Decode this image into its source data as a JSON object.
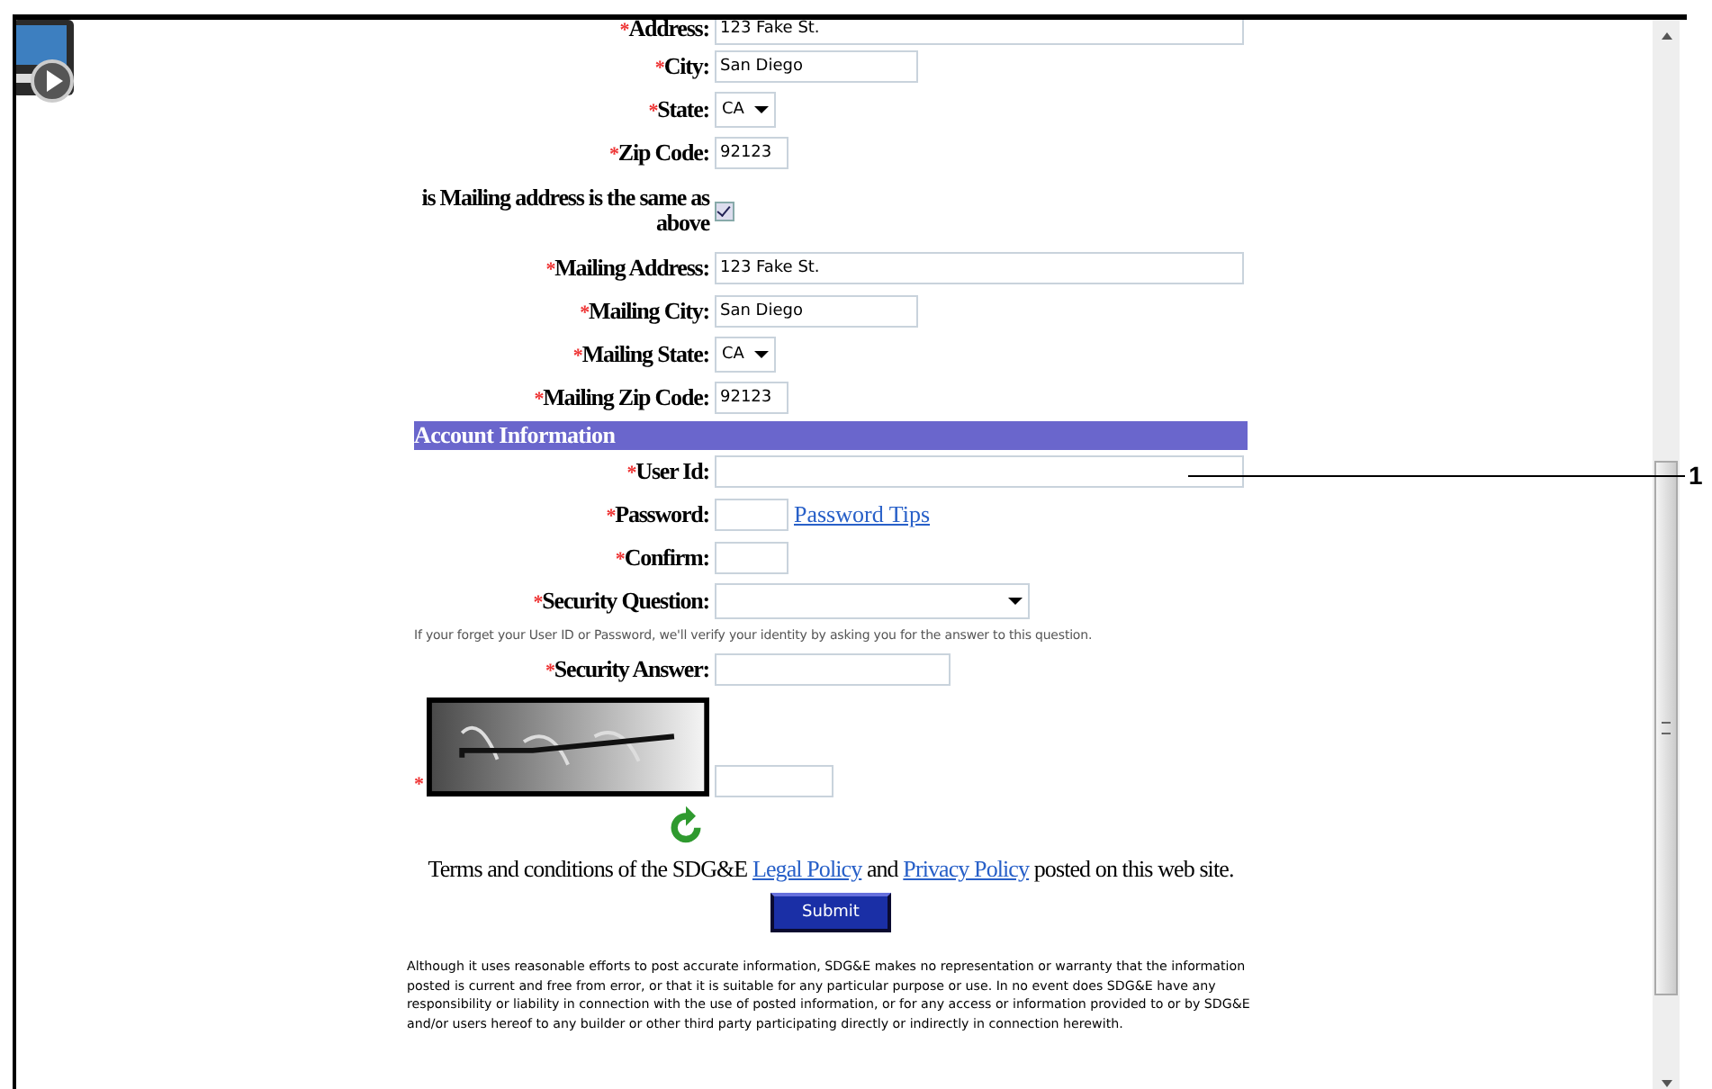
{
  "form": {
    "rows": [
      {
        "marker": "*",
        "label": "Address:",
        "kind": "long-text",
        "value": "123 Fake St."
      },
      {
        "marker": "*",
        "label": "City:",
        "kind": "medium-text",
        "value": "San Diego"
      },
      {
        "marker": "*",
        "label": "State:",
        "kind": "select",
        "value": "CA"
      },
      {
        "marker": "*",
        "label": "Zip Code:",
        "kind": "short-text",
        "value": "92123"
      },
      {
        "label": "is Mailing address is the same as above",
        "kind": "checkbox",
        "checked": true
      },
      {
        "marker": "*",
        "label": "Mailing Address:",
        "kind": "long-text",
        "value": "123 Fake St."
      },
      {
        "marker": "*",
        "label": "Mailing City:",
        "kind": "medium-text",
        "value": "San Diego"
      },
      {
        "marker": "*",
        "label": "Mailing State:",
        "kind": "select",
        "value": "CA"
      },
      {
        "marker": "*",
        "label": "Mailing Zip Code:",
        "kind": "short-text",
        "value": "92123"
      },
      {
        "kind": "header",
        "label": "Account Information"
      },
      {
        "marker": "*",
        "label": "User Id:",
        "kind": "long-text",
        "value": ""
      },
      {
        "marker": "*",
        "label": "Password:",
        "kind": "short-text",
        "value": "",
        "link": "Password Tips"
      },
      {
        "marker": "*",
        "label": "Confirm:",
        "kind": "short-text",
        "value": ""
      },
      {
        "marker": "*",
        "label": "Security Question:",
        "kind": "wide-select",
        "value": ""
      },
      {
        "kind": "hint",
        "label": "If your forget your User ID or Password, we'll verify your identity by asking you for the answer to this question."
      },
      {
        "marker": "*",
        "label": "Security Answer:",
        "kind": "answer-text",
        "value": ""
      },
      {
        "marker": "*",
        "kind": "captcha",
        "value": ""
      }
    ],
    "terms": [
      {
        "kind": "text",
        "text": "Terms and conditions of the SDG&E "
      },
      {
        "kind": "link",
        "text": "Legal Policy"
      },
      {
        "kind": "text",
        "text": " and "
      },
      {
        "kind": "link",
        "text": "Privacy Policy"
      },
      {
        "kind": "text",
        "text": " posted on this web site."
      }
    ],
    "submit": "Submit",
    "disclaimer": "Although it uses reasonable efforts to post accurate information, SDG&E makes no representation or warranty that the information posted is current and free from error, or that it is suitable for any particular purpose or use. In no event does SDG&E have any responsibility or liability in connection with the use of posted information, or for any access or information provided to or by SDG&E and/or users hereof to any builder or other third party participating directly or indirectly in connection herewith."
  },
  "callout": {
    "number": "1"
  }
}
